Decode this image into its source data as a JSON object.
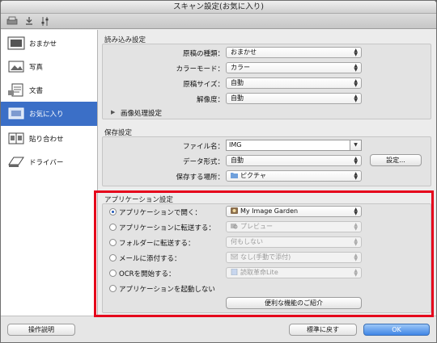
{
  "window": {
    "title": "スキャン設定(お気に入り)"
  },
  "toolbar": {
    "icons": [
      "scanner-icon",
      "download-icon",
      "settings-sliders-icon"
    ]
  },
  "sidebar": {
    "items": [
      {
        "label": "おまかせ",
        "icon": "auto-scan-icon"
      },
      {
        "label": "写真",
        "icon": "photo-icon"
      },
      {
        "label": "文書",
        "icon": "document-icon"
      },
      {
        "label": "お気に入り",
        "icon": "favorites-icon",
        "selected": true
      },
      {
        "label": "貼り合わせ",
        "icon": "stitch-icon"
      },
      {
        "label": "ドライバー",
        "icon": "driver-icon"
      }
    ]
  },
  "scan_settings": {
    "title": "読み込み設定",
    "rows": [
      {
        "label": "原稿の種類：",
        "value": "おまかせ"
      },
      {
        "label": "カラーモード：",
        "value": "カラー"
      },
      {
        "label": "原稿サイズ：",
        "value": "自動"
      },
      {
        "label": "解像度：",
        "value": "自動"
      }
    ],
    "image_processing": "画像処理設定"
  },
  "save_settings": {
    "title": "保存設定",
    "file_name_label": "ファイル名：",
    "file_name_value": "IMG",
    "data_format_label": "データ形式：",
    "data_format_value": "自動",
    "settings_button": "設定...",
    "save_location_label": "保存する場所：",
    "save_location_value": "ピクチャ"
  },
  "app_settings": {
    "title": "アプリケーション設定",
    "options": [
      {
        "label": "アプリケーションで開く：",
        "value": "My Image Garden",
        "checked": true
      },
      {
        "label": "アプリケーションに転送する：",
        "value": "プレビュー"
      },
      {
        "label": "フォルダーに転送する：",
        "value": "何もしない"
      },
      {
        "label": "メールに添付する：",
        "value": "なし(手動で添付)"
      },
      {
        "label": "OCRを開始する：",
        "value": "読取革命Lite"
      },
      {
        "label": "アプリケーションを起動しない"
      }
    ],
    "features_button": "便利な機能のご紹介"
  },
  "footer": {
    "help_button": "操作説明",
    "defaults_button": "標準に戻す",
    "ok_button": "OK"
  },
  "colors": {
    "selection": "#3b6fc7",
    "highlight": "#e5001b",
    "ok_button": "#3f86e6"
  }
}
